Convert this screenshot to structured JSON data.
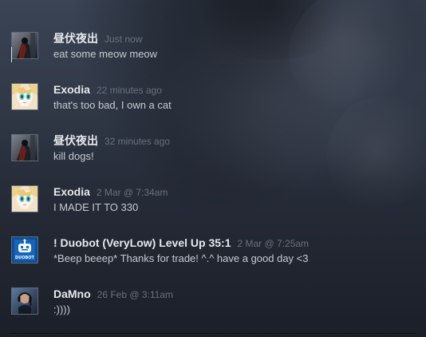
{
  "comments": [
    {
      "author": "昼伏夜出",
      "time": "Just now",
      "message": "eat some meow meow",
      "avatar": "dark-figure-avatar"
    },
    {
      "author": "Exodia",
      "time": "22 minutes ago",
      "message": "that's too bad, I own a cat",
      "avatar": "anime-girl-avatar"
    },
    {
      "author": "昼伏夜出",
      "time": "32 minutes ago",
      "message": "kill dogs!",
      "avatar": "dark-figure-avatar"
    },
    {
      "author": "Exodia",
      "time": "2 Mar @ 7:34am",
      "message": "I MADE IT TO 330",
      "avatar": "anime-girl-avatar"
    },
    {
      "author": "! Duobot (VeryLow) Level Up 35:1",
      "time": "2 Mar @ 7:25am",
      "message": "*Beep beeep* Thanks for trade! ^.^ have a good day <3",
      "avatar": "robot-avatar",
      "avatar_text": "DUOBOT"
    },
    {
      "author": "DaMno",
      "time": "26 Feb @ 3:11am",
      "message": ":))))",
      "avatar": "headset-user-avatar"
    }
  ],
  "colors": {
    "author": "#e6e8eb",
    "time": "#67717d",
    "message": "#c6cbd2",
    "background": "#1f2430",
    "avatar_border": "#5d6a7a"
  }
}
